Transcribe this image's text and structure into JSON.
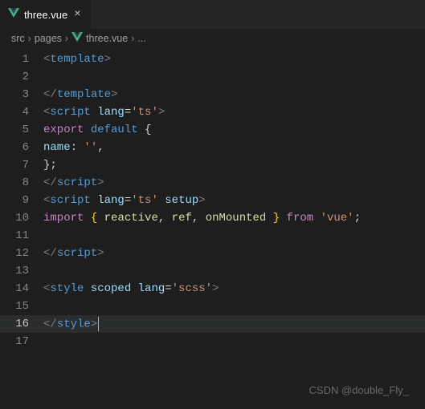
{
  "tab": {
    "label": "three.vue",
    "close": "×"
  },
  "breadcrumbs": {
    "items": [
      "src",
      "pages",
      "three.vue",
      "..."
    ],
    "sep": "›"
  },
  "code": {
    "l1": {
      "num": "1",
      "open": "<",
      "tag": "template",
      "close": ">"
    },
    "l2": {
      "num": "2"
    },
    "l3": {
      "num": "3",
      "open": "</",
      "tag": "template",
      "close": ">"
    },
    "l4": {
      "num": "4",
      "open": "<",
      "tag": "script",
      "attr": " lang",
      "eq": "=",
      "val": "'ts'",
      "close": ">"
    },
    "l5": {
      "num": "5",
      "kw1": "export",
      "kw2": " default",
      "brace": " {"
    },
    "l6": {
      "num": "6",
      "prop": "name",
      "colon": ": ",
      "val": "''",
      "comma": ","
    },
    "l7": {
      "num": "7",
      "brace": "}",
      "semi": ";"
    },
    "l8": {
      "num": "8",
      "open": "</",
      "tag": "script",
      "close": ">"
    },
    "l9": {
      "num": "9",
      "open": "<",
      "tag": "script",
      "attr1": " lang",
      "eq": "=",
      "val": "'ts'",
      "attr2": " setup",
      "close": ">"
    },
    "l10": {
      "num": "10",
      "kw": "import",
      "brace1": " { ",
      "fn1": "reactive",
      "c1": ", ",
      "fn2": "ref",
      "c2": ", ",
      "fn3": "onMounted",
      "brace2": " } ",
      "from": "from",
      "sp": " ",
      "mod": "'vue'",
      "semi": ";"
    },
    "l11": {
      "num": "11"
    },
    "l12": {
      "num": "12",
      "open": "</",
      "tag": "script",
      "close": ">"
    },
    "l13": {
      "num": "13"
    },
    "l14": {
      "num": "14",
      "open": "<",
      "tag": "style",
      "attr1": " scoped",
      "attr2": " lang",
      "eq": "=",
      "val": "'scss'",
      "close": ">"
    },
    "l15": {
      "num": "15"
    },
    "l16": {
      "num": "16",
      "open": "</",
      "tag": "style",
      "close": ">"
    },
    "l17": {
      "num": "17"
    }
  },
  "watermark": "CSDN @double_Fly_"
}
